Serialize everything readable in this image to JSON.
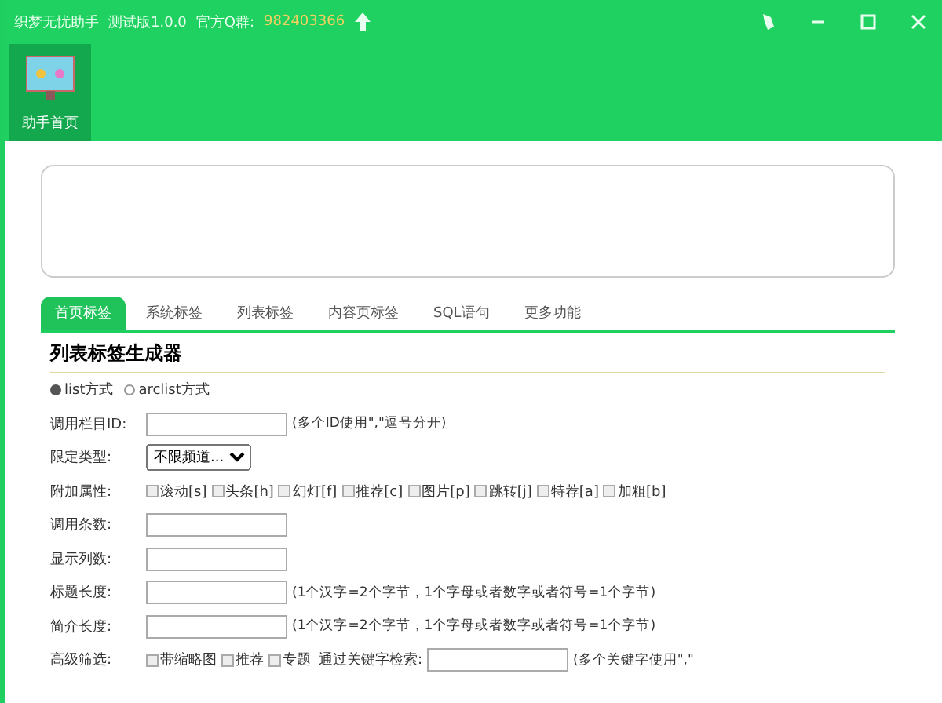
{
  "window": {
    "title": "织梦无忧助手",
    "version": "测试版1.0.0",
    "group_label": "官方Q群:",
    "group_number": "982403366"
  },
  "nav": [
    {
      "label": "助手首页",
      "selected": true
    }
  ],
  "tabs": [
    {
      "label": "首页标签",
      "selected": true
    },
    {
      "label": "系统标签",
      "selected": false
    },
    {
      "label": "列表标签",
      "selected": false
    },
    {
      "label": "内容页标签",
      "selected": false
    },
    {
      "label": "SQL语句",
      "selected": false
    },
    {
      "label": "更多功能",
      "selected": false
    }
  ],
  "heading": "列表标签生成器",
  "modes": [
    {
      "label": "list方式",
      "selected": true
    },
    {
      "label": "arclist方式",
      "selected": false
    }
  ],
  "rows": [
    {
      "kind": "input",
      "label": "调用栏目ID:",
      "hint": "(多个ID使用\",\"逗号分开)"
    },
    {
      "kind": "select",
      "label": "限定类型:",
      "value": "不限频道..."
    },
    {
      "kind": "checks",
      "label": "附加属性:",
      "options": [
        {
          "label": "滚动[s]",
          "checked": false
        },
        {
          "label": "头条[h]",
          "checked": false
        },
        {
          "label": "幻灯[f]",
          "checked": false
        },
        {
          "label": "推荐[c]",
          "checked": false
        },
        {
          "label": "图片[p]",
          "checked": false
        },
        {
          "label": "跳转[j]",
          "checked": false
        },
        {
          "label": "特荐[a]",
          "checked": false
        },
        {
          "label": "加粗[b]",
          "checked": false
        }
      ]
    },
    {
      "kind": "input",
      "label": "调用条数:"
    },
    {
      "kind": "input",
      "label": "显示列数:"
    },
    {
      "kind": "input",
      "label": "标题长度:",
      "hint": "(1个汉字=2个字节，1个字母或者数字或者符号=1个字节)"
    },
    {
      "kind": "input",
      "label": "简介长度:",
      "hint": "(1个汉字=2个字节，1个字母或者数字或者符号=1个字节)"
    },
    {
      "kind": "filter",
      "label": "高级筛选:",
      "options": [
        {
          "label": "带缩略图",
          "checked": false
        },
        {
          "label": "推荐",
          "checked": false
        },
        {
          "label": "专题",
          "checked": false
        }
      ],
      "search_label": "通过关键字检索:",
      "hint": "(多个关键字使用\",\""
    }
  ]
}
